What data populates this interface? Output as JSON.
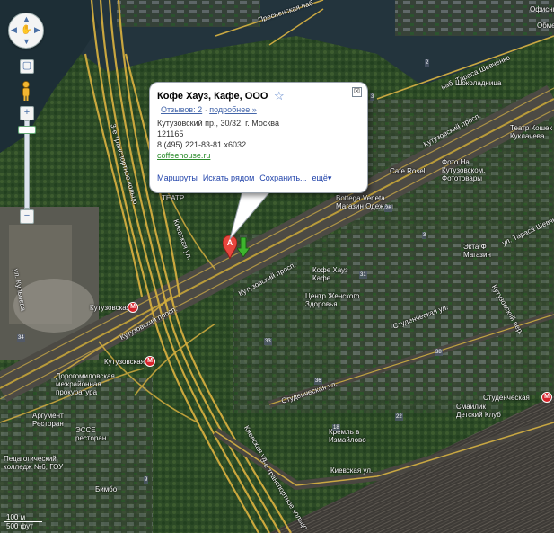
{
  "info_window": {
    "title": "Кофе Хауз, Кафе, ООО",
    "reviews": "Отзывов: 2",
    "more": "подробнее »",
    "address": "Кутузовский пр., 30/32, г. Москва",
    "postcode": "121165",
    "phone": "8 (495) 221-83-81 x6032",
    "website": "coffeehouse.ru",
    "actions": [
      "Маршруты",
      "Искать рядом",
      "Сохранить...",
      "ещё▾"
    ],
    "close_symbol": "☒"
  },
  "marker_letter": "A",
  "nav": {
    "zoom_in": "+",
    "zoom_out": "−",
    "center": "▢"
  },
  "labels": {
    "presnenskaya": "Пресненская наб.",
    "taras": "наб. Тараса Шевченко",
    "shokoladnitsa": "Шоколадница",
    "kutuz_prosp_ne": "Кутузовский просп.",
    "kutuz_prosp_mid": "Кутузовский просп.",
    "kutuz_prosp_w": "Кутузовский просп.",
    "kutuzovskaya_metro": "Кутузовская",
    "kutuzovskaya_metro2": "Кутузовская",
    "transport_ring_n": "3-е транспортное кольцо",
    "transport_ring_s": "3-е транспортное кольцо",
    "kievskaya_ul": "Киевская ул.",
    "kievskaya_ul2": "Киевская ул.",
    "kievskaya_ul3": "Киевская ул.",
    "studencheskaya": "Студенческая ул.",
    "studencheskaya2": "Студенческая ул.",
    "studencheskaya_metro": "Студенческая",
    "kofe_haus": "Кофе Хауз\nКафе",
    "centr_zdor": "Центр Женского\nЗдоровья",
    "dorogomilovo": "Дорогомиловская\nмежрайонная\nпрокуратура",
    "argument": "Аргумент\nРесторан",
    "essie": "ЭССЕ\nресторан",
    "ped_college": "Педагогический\nколледж №6, ГОУ",
    "cafe_rosel": "Cafe Rosel",
    "photo_na": "Фото На\nКутузовском,\nФототовары",
    "bottega": "Bottega Veneta\nМагазин Одежды",
    "ekta": "Экта Ф\nМагазин",
    "kofe_koshek": "Театр Кошек\nКуклачева",
    "smailik": "Смайлик\nДетский Клуб",
    "kreml": "Кремль в\nИзмайлово",
    "teatr": "ТЕАТР",
    "office": "Офисный\nКомплекс",
    "obmen": "Обмен",
    "bimbo": "Бимбо",
    "ul_kulneva": "ул. Кульнева",
    "kutuz_per": "Кутузовский пер.",
    "chevchenko": "ул. Тараса Шевченко"
  },
  "scale": {
    "top": "100 м",
    "bottom": "500 фут"
  }
}
